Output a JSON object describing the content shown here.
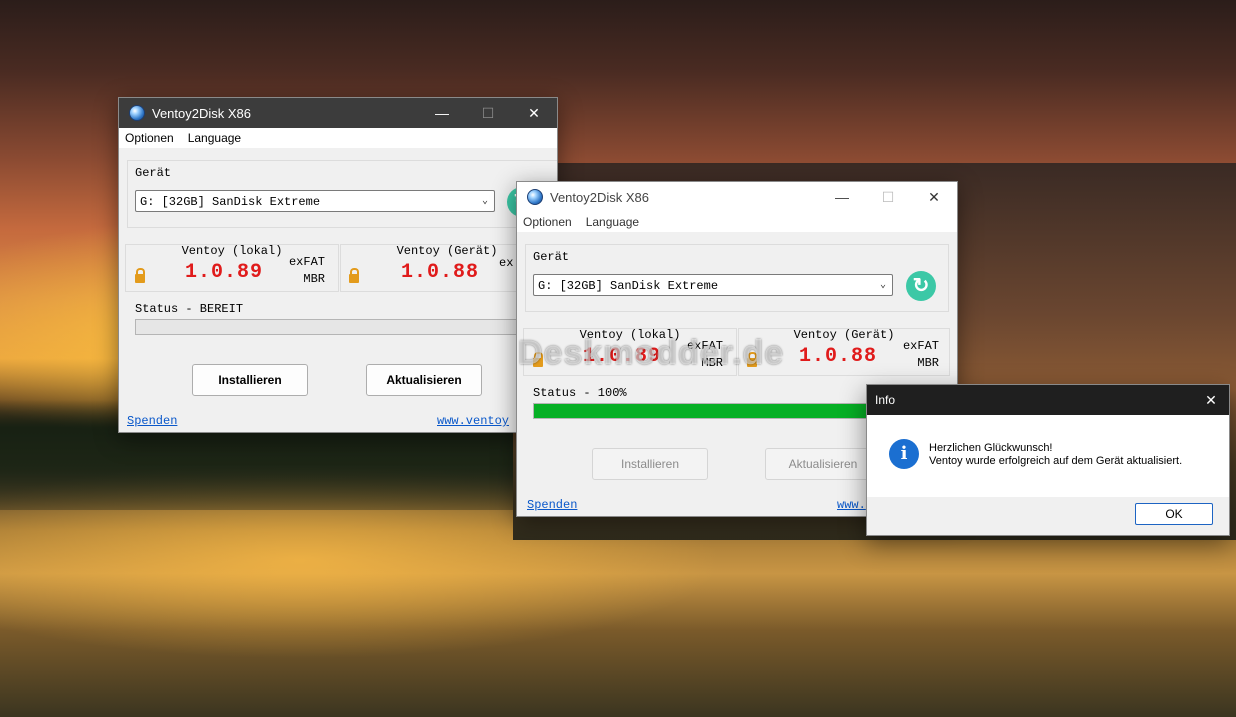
{
  "win_back": {
    "title": "Ventoy2Disk  X86",
    "menu": [
      "Optionen",
      "Language"
    ],
    "device_label": "Gerät",
    "device_value": "G: [32GB] SanDisk Extreme",
    "local_title": "Ventoy (lokal)",
    "local_version": "1.0.89",
    "local_fs": "exFAT",
    "local_part": "MBR",
    "device_title": "Ventoy (Gerät)",
    "device_version": "1.0.88",
    "device_fs_partial": "ex",
    "status": "Status - BEREIT",
    "progress": 0,
    "install_label": "Installieren",
    "update_label": "Aktualisieren",
    "donate_label": "Spenden",
    "website_partial": "www.ventoy"
  },
  "win_front": {
    "title": "Ventoy2Disk  X86",
    "menu": [
      "Optionen",
      "Language"
    ],
    "device_label": "Gerät",
    "device_value": "G: [32GB] SanDisk Extreme",
    "local_title": "Ventoy (lokal)",
    "local_version": "1.0.89",
    "local_fs": "exFAT",
    "local_part": "MBR",
    "device_title": "Ventoy (Gerät)",
    "device_version": "1.0.88",
    "device_fs": "exFAT",
    "device_part": "MBR",
    "status": "Status - 100%",
    "progress": 1.0,
    "install_label": "Installieren",
    "update_label": "Aktualisieren",
    "donate_label": "Spenden",
    "website_partial": "www."
  },
  "dialog": {
    "title": "Info",
    "line1": "Herzlichen Glückwunsch!",
    "line2": "Ventoy wurde erfolgreich auf dem Gerät aktualisiert.",
    "ok_label": "OK"
  },
  "watermark": "Deskmodder.de",
  "colors": {
    "version_red": "#e01b1b",
    "progress_green": "#06b025",
    "refresh_teal": "#3cc8a6",
    "info_blue": "#1b6fd1"
  },
  "icons": {
    "lock": "lock-icon",
    "refresh": "refresh-icon",
    "info": "info-icon",
    "close": "close-icon"
  }
}
